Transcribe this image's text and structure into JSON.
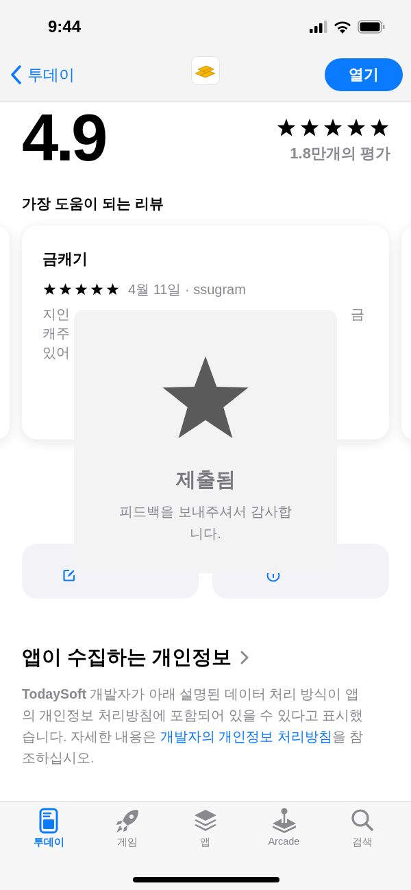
{
  "status_bar": {
    "time": "9:44"
  },
  "nav": {
    "back": "투데이",
    "open_button": "열기"
  },
  "ratings": {
    "score": "4.9",
    "stars": 5,
    "count": "1.8만개의 평가"
  },
  "reviews": {
    "title": "가장 도움이 되는 리뷰",
    "card": {
      "title": "금캐기",
      "stars": 5,
      "meta": "4월 11일 · ssugram",
      "lines": [
        {
          "left": "지인",
          "right": "금"
        },
        {
          "left": "캐주"
        },
        {
          "left": "있어"
        }
      ]
    }
  },
  "actions": [
    {
      "kind": "write"
    },
    {
      "kind": "support"
    }
  ],
  "hud": {
    "title": "제출됨",
    "message": "피드백을 보내주셔서 감사합니다."
  },
  "privacy": {
    "title": "앱이 수집하는 개인정보",
    "text": "**TodaySoft** 개발자가 아래 설명된 데이터 처리 방식이 앱의 개인정보 처리방침에 포함되어 있을 수 있다고 표시했습니다. 자세한 내용은 ",
    "link": "개발자의 개인정보 처리방침",
    "after": "을 참조하십시오."
  },
  "tabs": [
    {
      "label": "투데이",
      "selected": true,
      "kind": "today"
    },
    {
      "label": "게임",
      "selected": false,
      "kind": "games"
    },
    {
      "label": "앱",
      "selected": false,
      "kind": "apps"
    },
    {
      "label": "Arcade",
      "selected": false,
      "kind": "arcade"
    },
    {
      "label": "검색",
      "selected": false,
      "kind": "search"
    }
  ]
}
